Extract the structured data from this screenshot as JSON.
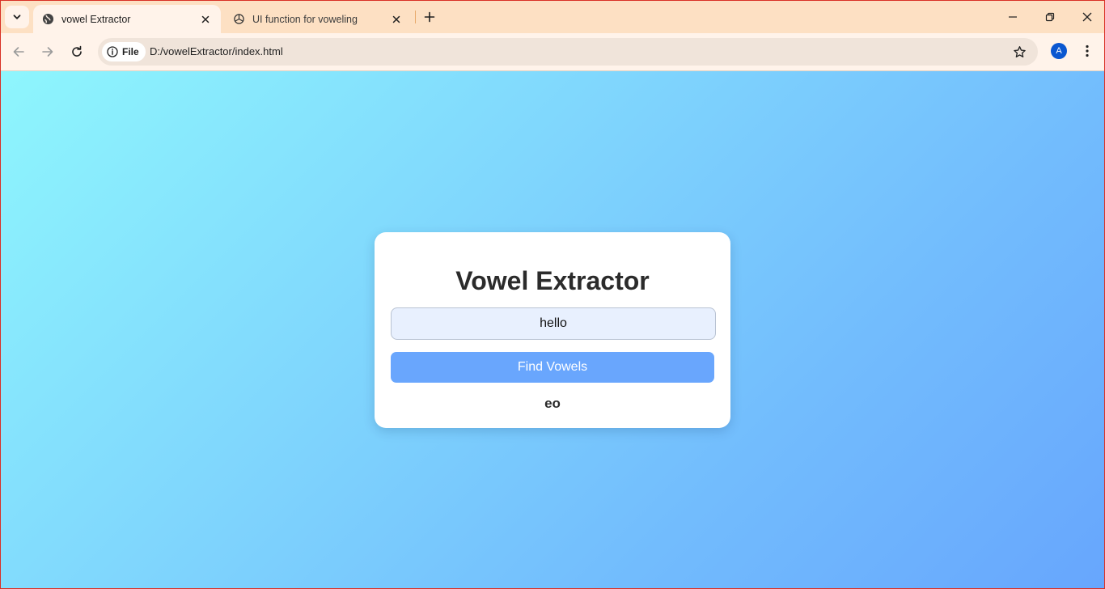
{
  "browser": {
    "tabs": [
      {
        "title": "vowel Extractor",
        "icon": "globe-icon",
        "active": true
      },
      {
        "title": "UI function for voweling",
        "icon": "openai-icon",
        "active": false
      }
    ],
    "address_bar": {
      "chip_label": "File",
      "url": "D:/vowelExtractor/index.html"
    },
    "profile_initial": "A",
    "accent_color": "#0b57d0",
    "frame_color": "#fde0c3"
  },
  "page": {
    "title": "Vowel Extractor",
    "input_value": "hello",
    "button_label": "Find Vowels",
    "result": "eo",
    "button_color": "#69a6fd",
    "gradient_colors": [
      "#8ef6fd",
      "#67a6fd"
    ]
  }
}
